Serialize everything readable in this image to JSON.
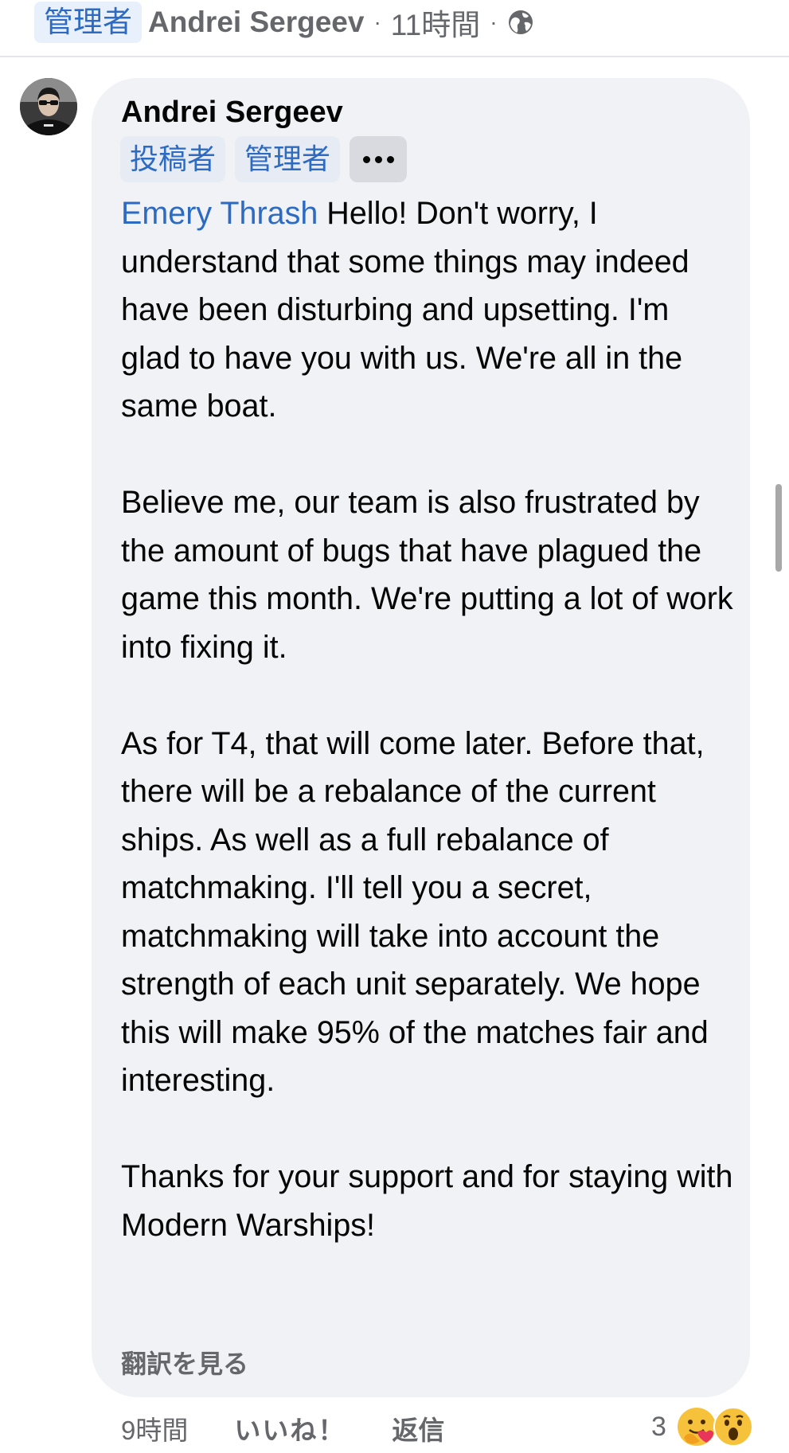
{
  "header": {
    "badge": "管理者",
    "author": "Andrei Sergeev",
    "separator": "·",
    "time": "11時間",
    "privacy_icon": "globe-icon"
  },
  "comment": {
    "author": "Andrei Sergeev",
    "badges": [
      "投稿者",
      "管理者"
    ],
    "more_icon": "more-dots-icon",
    "mention": "Emery Thrash",
    "paragraph_1_rest": " Hello! Don't worry, I understand that some things may indeed have been disturbing and upsetting. I'm glad to have you with us. We're all in the same boat.",
    "paragraph_2": "Believe me, our team is also frustrated by the amount of bugs that have plagued the game this month. We're putting a lot of work into fixing it.",
    "paragraph_3": "As for T4, that will come later. Before that, there will be a rebalance of the current ships. As well as a full rebalance of matchmaking. I'll tell you a secret, matchmaking will take into account the strength of each unit separately. We hope this will make 95% of the matches fair and interesting.",
    "paragraph_4": "Thanks for your support and for staying with Modern Warships!",
    "translate": "翻訳を見る"
  },
  "footer": {
    "time": "9時間",
    "like": "いいね！",
    "reply": "返信",
    "reaction_count": "3",
    "reactions": [
      "care-emoji-icon",
      "wow-emoji-icon"
    ]
  },
  "colors": {
    "accent": "#2d6bc3",
    "bubble": "#f0f2f5",
    "muted": "#65676b"
  }
}
